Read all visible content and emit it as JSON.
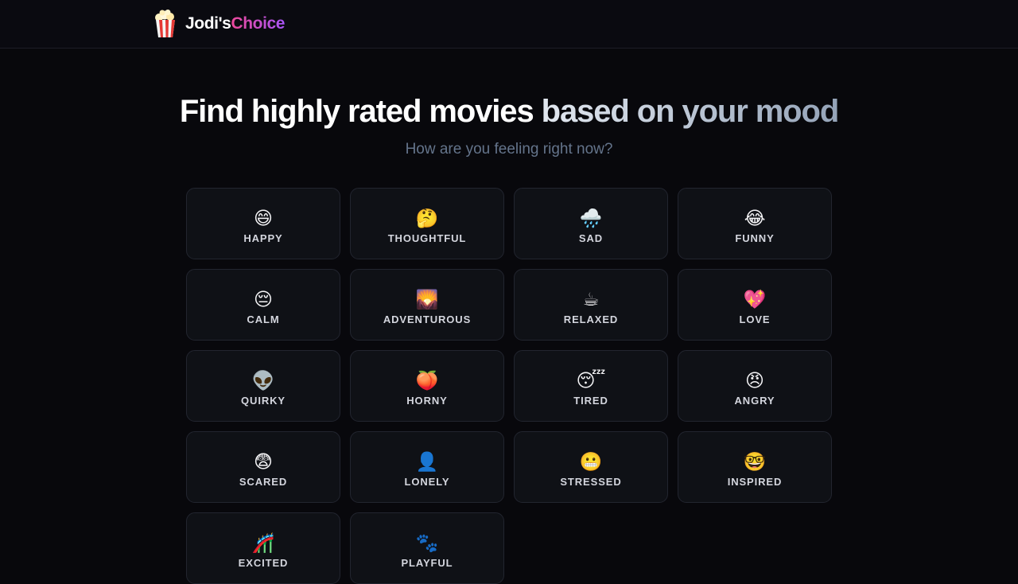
{
  "brand": {
    "part1": "Jodi's",
    "part2": "Choice",
    "logo": "popcorn-icon"
  },
  "hero": {
    "headline_a": "Find highly rated movies",
    "headline_b": "based on your mood",
    "subtitle": "How are you feeling right now?"
  },
  "moods": [
    {
      "label": "HAPPY",
      "emoji": "😄",
      "icon": "grinning-face-icon"
    },
    {
      "label": "THOUGHTFUL",
      "emoji": "🤔",
      "icon": "thinking-face-icon"
    },
    {
      "label": "SAD",
      "emoji": "🌧️",
      "icon": "rain-cloud-icon"
    },
    {
      "label": "FUNNY",
      "emoji": "😂",
      "icon": "tears-of-joy-icon"
    },
    {
      "label": "CALM",
      "emoji": "😔",
      "icon": "pensive-face-icon"
    },
    {
      "label": "ADVENTUROUS",
      "emoji": "🌄",
      "icon": "sunrise-mountains-icon"
    },
    {
      "label": "RELAXED",
      "emoji": "☕",
      "icon": "coffee-icon"
    },
    {
      "label": "LOVE",
      "emoji": "💖",
      "icon": "sparkling-heart-icon"
    },
    {
      "label": "QUIRKY",
      "emoji": "👽",
      "icon": "alien-icon"
    },
    {
      "label": "HORNY",
      "emoji": "🍑",
      "icon": "peach-icon"
    },
    {
      "label": "TIRED",
      "emoji": "😴",
      "icon": "sleeping-face-icon"
    },
    {
      "label": "ANGRY",
      "emoji": "😠",
      "icon": "angry-face-icon"
    },
    {
      "label": "SCARED",
      "emoji": "😨",
      "icon": "fearful-face-icon"
    },
    {
      "label": "LONELY",
      "emoji": "👤",
      "icon": "silhouette-icon"
    },
    {
      "label": "STRESSED",
      "emoji": "😬",
      "icon": "grimacing-face-icon"
    },
    {
      "label": "INSPIRED",
      "emoji": "🤓",
      "icon": "nerd-face-icon"
    },
    {
      "label": "EXCITED",
      "emoji": "🎢",
      "icon": "roller-coaster-icon"
    },
    {
      "label": "PLAYFUL",
      "emoji": "🐾",
      "icon": "paw-prints-icon"
    }
  ]
}
